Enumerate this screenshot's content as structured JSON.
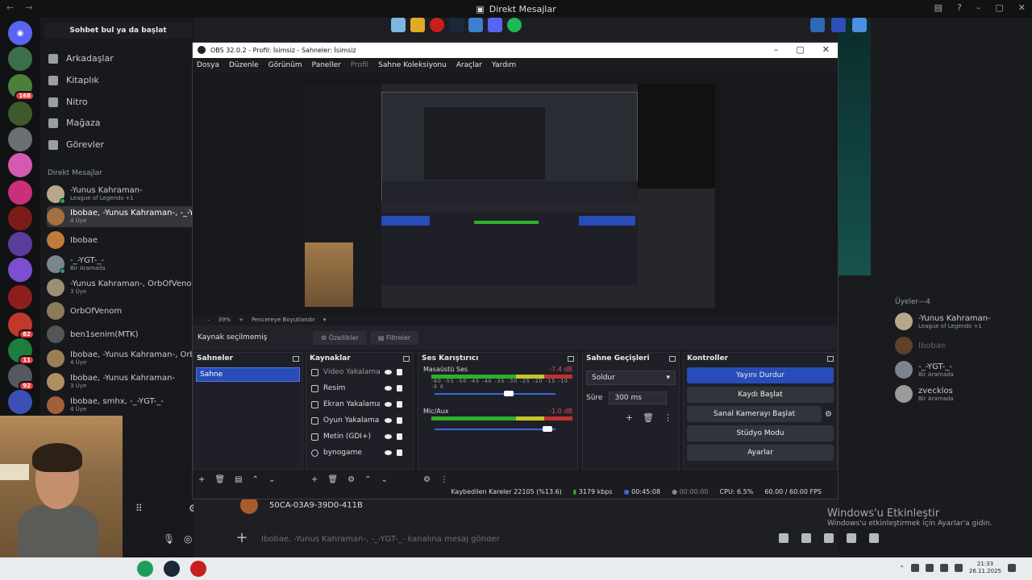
{
  "topbar": {
    "title": "Direkt Mesajlar"
  },
  "dm": {
    "search": "Sohbet bul ya da başlat",
    "nav": [
      "Arkadaşlar",
      "Kitaplık",
      "Nitro",
      "Mağaza",
      "Görevler"
    ],
    "header": "Direkt Mesajlar",
    "items": [
      {
        "name": "-Yunus Kahraman-",
        "sub": "League of Legends +1"
      },
      {
        "name": "Ibobae, -Yunus Kahraman-, -_-YGT",
        "sub": "4 Üye"
      },
      {
        "name": "Ibobae",
        "sub": ""
      },
      {
        "name": "-_-YGT-_-",
        "sub": "Bir Aramada"
      },
      {
        "name": "-Yunus Kahraman-, OrbOfVenom",
        "sub": "3 Üye"
      },
      {
        "name": "OrbOfVenom",
        "sub": ""
      },
      {
        "name": "ben1senim(MTK)",
        "sub": ""
      },
      {
        "name": "Ibobae, -Yunus Kahraman-, OrbO",
        "sub": "4 Üye"
      },
      {
        "name": "Ibobae, -Yunus Kahraman-",
        "sub": "3 Üye"
      },
      {
        "name": "Ibobae, smhx, -_-YGT-_-",
        "sub": "4 Üye"
      }
    ],
    "badges": [
      "168",
      "82",
      "62",
      "11",
      "92"
    ]
  },
  "obs": {
    "title": "OBS 32.0.2 - Profil: İsimsiz - Sahneler: İsimsiz",
    "menu": [
      "Dosya",
      "Düzenle",
      "Görünüm",
      "Paneller",
      "Profil",
      "Sahne Koleksiyonu",
      "Araçlar",
      "Yardım"
    ],
    "zoom": "39%",
    "zoom_mode": "Pencereye Boyutlandır",
    "no_source": "Kaynak seçilmemiş",
    "props": "Özellikler",
    "filters": "Filtreler",
    "scenes": {
      "title": "Sahneler",
      "items": [
        "Sahne"
      ]
    },
    "sources": {
      "title": "Kaynaklar",
      "items": [
        "Video Yakalama /",
        "Resim",
        "Ekran Yakalama",
        "Oyun Yakalama",
        "Metin (GDI+)",
        "bynogame"
      ]
    },
    "mixer": {
      "title": "Ses Karıştırıcı",
      "scale": "-60 -55 -50 -45 -40 -35 -30 -25 -20 -15 -10 -5 0",
      "channels": [
        {
          "name": "Masaüstü Ses",
          "db": "-7.4 dB",
          "level": 0.62
        },
        {
          "name": "Mic/Aux",
          "db": "-1.0 dB",
          "level": 0.97
        }
      ]
    },
    "transitions": {
      "title": "Sahne Geçişleri",
      "type": "Soldur",
      "dur_label": "Süre",
      "dur": "300 ms"
    },
    "controls": {
      "title": "Kontroller",
      "buttons": [
        "Yayını Durdur",
        "Kaydı Başlat",
        "Sanal Kamerayı Başlat",
        "Stüdyo Modu",
        "Ayarlar"
      ]
    },
    "status": {
      "dropped": "Kaybedilen Kareler 22105 (%13.6)",
      "kbps": "3179 kbps",
      "time": "00:45:08",
      "rec": "00:00:00",
      "cpu": "CPU: 6.5%",
      "fps": "60.00 / 60.00 FPS"
    }
  },
  "members": {
    "header": "Üyeler—4",
    "items": [
      {
        "name": "-Yunus Kahraman-",
        "sub": "League of Legends +1"
      },
      {
        "name": "Ibobae",
        "sub": ""
      },
      {
        "name": "-_-YGT-_-",
        "sub": "Bir Aramada"
      },
      {
        "name": "zvecklos",
        "sub": "Bir Aramada"
      }
    ]
  },
  "chat": {
    "code": "50CA-03A9-39D0-411B",
    "placeholder": "Ibobae, -Yunus Kahraman-, -_-YGT-_- kanalına mesaj gönder"
  },
  "watermark": {
    "line1": "Windows'u Etkinleştir",
    "line2": "Windows'u etkinleştirmek için Ayarlar'a gidin."
  },
  "clock": {
    "time": "21:33",
    "date": "26.11.2025"
  }
}
